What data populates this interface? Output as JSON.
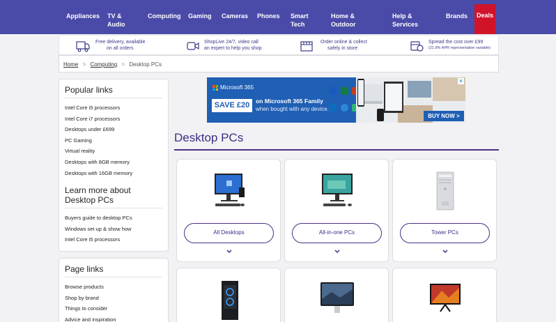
{
  "nav": {
    "items": [
      "Appliances",
      "TV & Audio",
      "Computing",
      "Gaming",
      "Cameras",
      "Phones",
      "Smart Tech",
      "Home & Outdoor",
      "Help & Services",
      "Brands"
    ],
    "deals": "Deals"
  },
  "usp": {
    "delivery_l1": "Free delivery, available",
    "delivery_l2": "on all orders",
    "shoplive_l1": "ShopLive 24/7, video call",
    "shoplive_l2": "an expert to help you shop",
    "collect_l1": "Order online & collect",
    "collect_l2": "safely in store",
    "spread_l1": "Spread the cost over £99",
    "spread_l2": "(21.9% APR representative variable)"
  },
  "breadcrumb": {
    "home": "Home",
    "computing": "Computing",
    "current": "Desktop PCs",
    "sep": ">"
  },
  "popular": {
    "heading": "Popular links",
    "links": [
      "Intel Core i5 processors",
      "Intel Core i7 processors",
      "Desktops under £699",
      "PC Gaming",
      "Virtual reality",
      "Desktops with 8GB memory",
      "Desktops with 16GB memory"
    ]
  },
  "learn": {
    "heading": "Learn more about Desktop PCs",
    "links": [
      "Buyers guide to desktop PCs",
      "Windows set up & show how",
      "Intel Core i5 processors"
    ]
  },
  "pagelinks": {
    "heading": "Page links",
    "links": [
      "Browse products",
      "Shop by brand",
      "Things to consider",
      "Advice and inspiration"
    ]
  },
  "banner": {
    "brand": "Microsoft 365",
    "save": "SAVE £20",
    "offer": "on Microsoft 365 Family",
    "offer_sub": "when bought with any device.",
    "cta": "BUY NOW >",
    "close": "✕"
  },
  "page_title": "Desktop PCs",
  "categories": [
    {
      "label": "All Desktops"
    },
    {
      "label": "All-in-one PCs"
    },
    {
      "label": "Tower PCs"
    }
  ],
  "colors": {
    "nav": "#4a4aa8",
    "deals": "#d1132a",
    "accent": "#4b2f86",
    "banner": "#1f5fb4"
  }
}
